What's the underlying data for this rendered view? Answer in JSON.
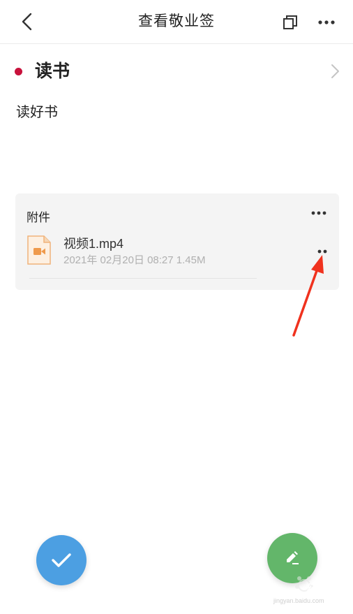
{
  "header": {
    "title": "查看敬业签",
    "back_icon": "chevron-left-icon",
    "copy_icon": "copy-icon",
    "more_icon": "more-horizontal-icon"
  },
  "note": {
    "category_color": "#c8123c",
    "title": "读书",
    "body": "读好书"
  },
  "attachments": {
    "header": "附件",
    "items": [
      {
        "name": "视频1.mp4",
        "meta": "2021年 02月20日 08:27  1.45M",
        "icon": "video-file-icon"
      }
    ]
  },
  "actions": {
    "done_icon": "check-icon",
    "done_color": "#4c9fe2",
    "edit_icon": "pencil-icon",
    "edit_color": "#63b66a"
  },
  "watermark": {
    "text": "经验",
    "url": "jingyan.baidu.com"
  },
  "colors": {
    "annotation_arrow": "#f0321e"
  }
}
